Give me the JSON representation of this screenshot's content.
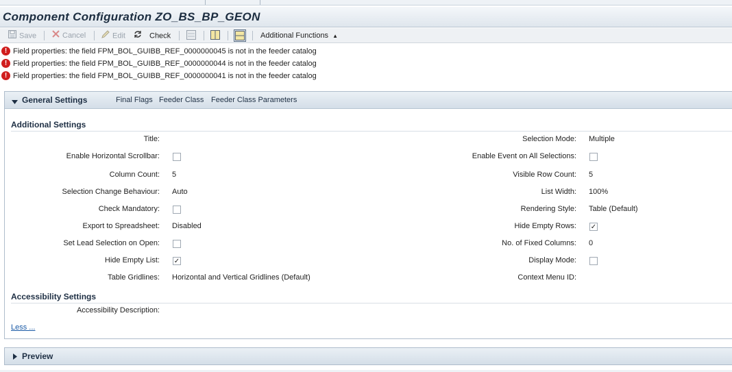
{
  "title": "Component Configuration ZO_BS_BP_GEON",
  "toolbar": {
    "save": "Save",
    "cancel": "Cancel",
    "edit": "Edit",
    "check": "Check",
    "additional_functions": "Additional Functions"
  },
  "messages": [
    {
      "icon": "error-icon",
      "text": "Field properties: the field FPM_BOL_GUIBB_REF_0000000045 is not in the feeder catalog"
    },
    {
      "icon": "error-icon",
      "text": "Field properties: the field FPM_BOL_GUIBB_REF_0000000044 is not in the feeder catalog"
    },
    {
      "icon": "error-icon",
      "text": "Field properties: the field FPM_BOL_GUIBB_REF_0000000041 is not in the feeder catalog"
    }
  ],
  "general": {
    "title": "General Settings",
    "links": [
      "Final Flags",
      "Feeder Class",
      "Feeder Class Parameters"
    ]
  },
  "additional": {
    "title": "Additional Settings",
    "left": [
      {
        "label": "Title:",
        "value": "",
        "type": "text"
      },
      {
        "label": "Enable Horizontal Scrollbar:",
        "value": "",
        "type": "checkbox",
        "checked": false
      },
      {
        "label": "Column Count:",
        "value": "5",
        "type": "text"
      },
      {
        "label": "Selection Change Behaviour:",
        "value": "Auto",
        "type": "text"
      },
      {
        "label": "Check Mandatory:",
        "value": "",
        "type": "checkbox",
        "checked": false
      },
      {
        "label": "Export to Spreadsheet:",
        "value": "Disabled",
        "type": "text"
      },
      {
        "label": "Set Lead Selection on Open:",
        "value": "",
        "type": "checkbox",
        "checked": false
      },
      {
        "label": "Hide Empty List:",
        "value": "",
        "type": "checkbox",
        "checked": true
      },
      {
        "label": "Table Gridlines:",
        "value": "Horizontal and Vertical Gridlines (Default)",
        "type": "text"
      }
    ],
    "right": [
      {
        "label": "Selection Mode:",
        "value": "Multiple",
        "type": "text"
      },
      {
        "label": "Enable Event on All Selections:",
        "value": "",
        "type": "checkbox",
        "checked": false
      },
      {
        "label": "Visible Row Count:",
        "value": "5",
        "type": "text"
      },
      {
        "label": "List Width:",
        "value": "100%",
        "type": "text"
      },
      {
        "label": "Rendering Style:",
        "value": "Table (Default)",
        "type": "text"
      },
      {
        "label": "Hide Empty Rows:",
        "value": "",
        "type": "checkbox",
        "checked": true
      },
      {
        "label": "No. of Fixed Columns:",
        "value": "0",
        "type": "text"
      },
      {
        "label": "Display Mode:",
        "value": "",
        "type": "checkbox",
        "checked": false
      },
      {
        "label": "Context Menu ID:",
        "value": "",
        "type": "text"
      }
    ]
  },
  "accessibility": {
    "title": "Accessibility Settings",
    "description_label": "Accessibility Description:",
    "description_value": ""
  },
  "less_link": "Less ...",
  "preview": {
    "title": "Preview"
  },
  "colors": {
    "error": "#d01e1e",
    "link": "#1a5aa6",
    "header_bg": "#d4dee8"
  }
}
